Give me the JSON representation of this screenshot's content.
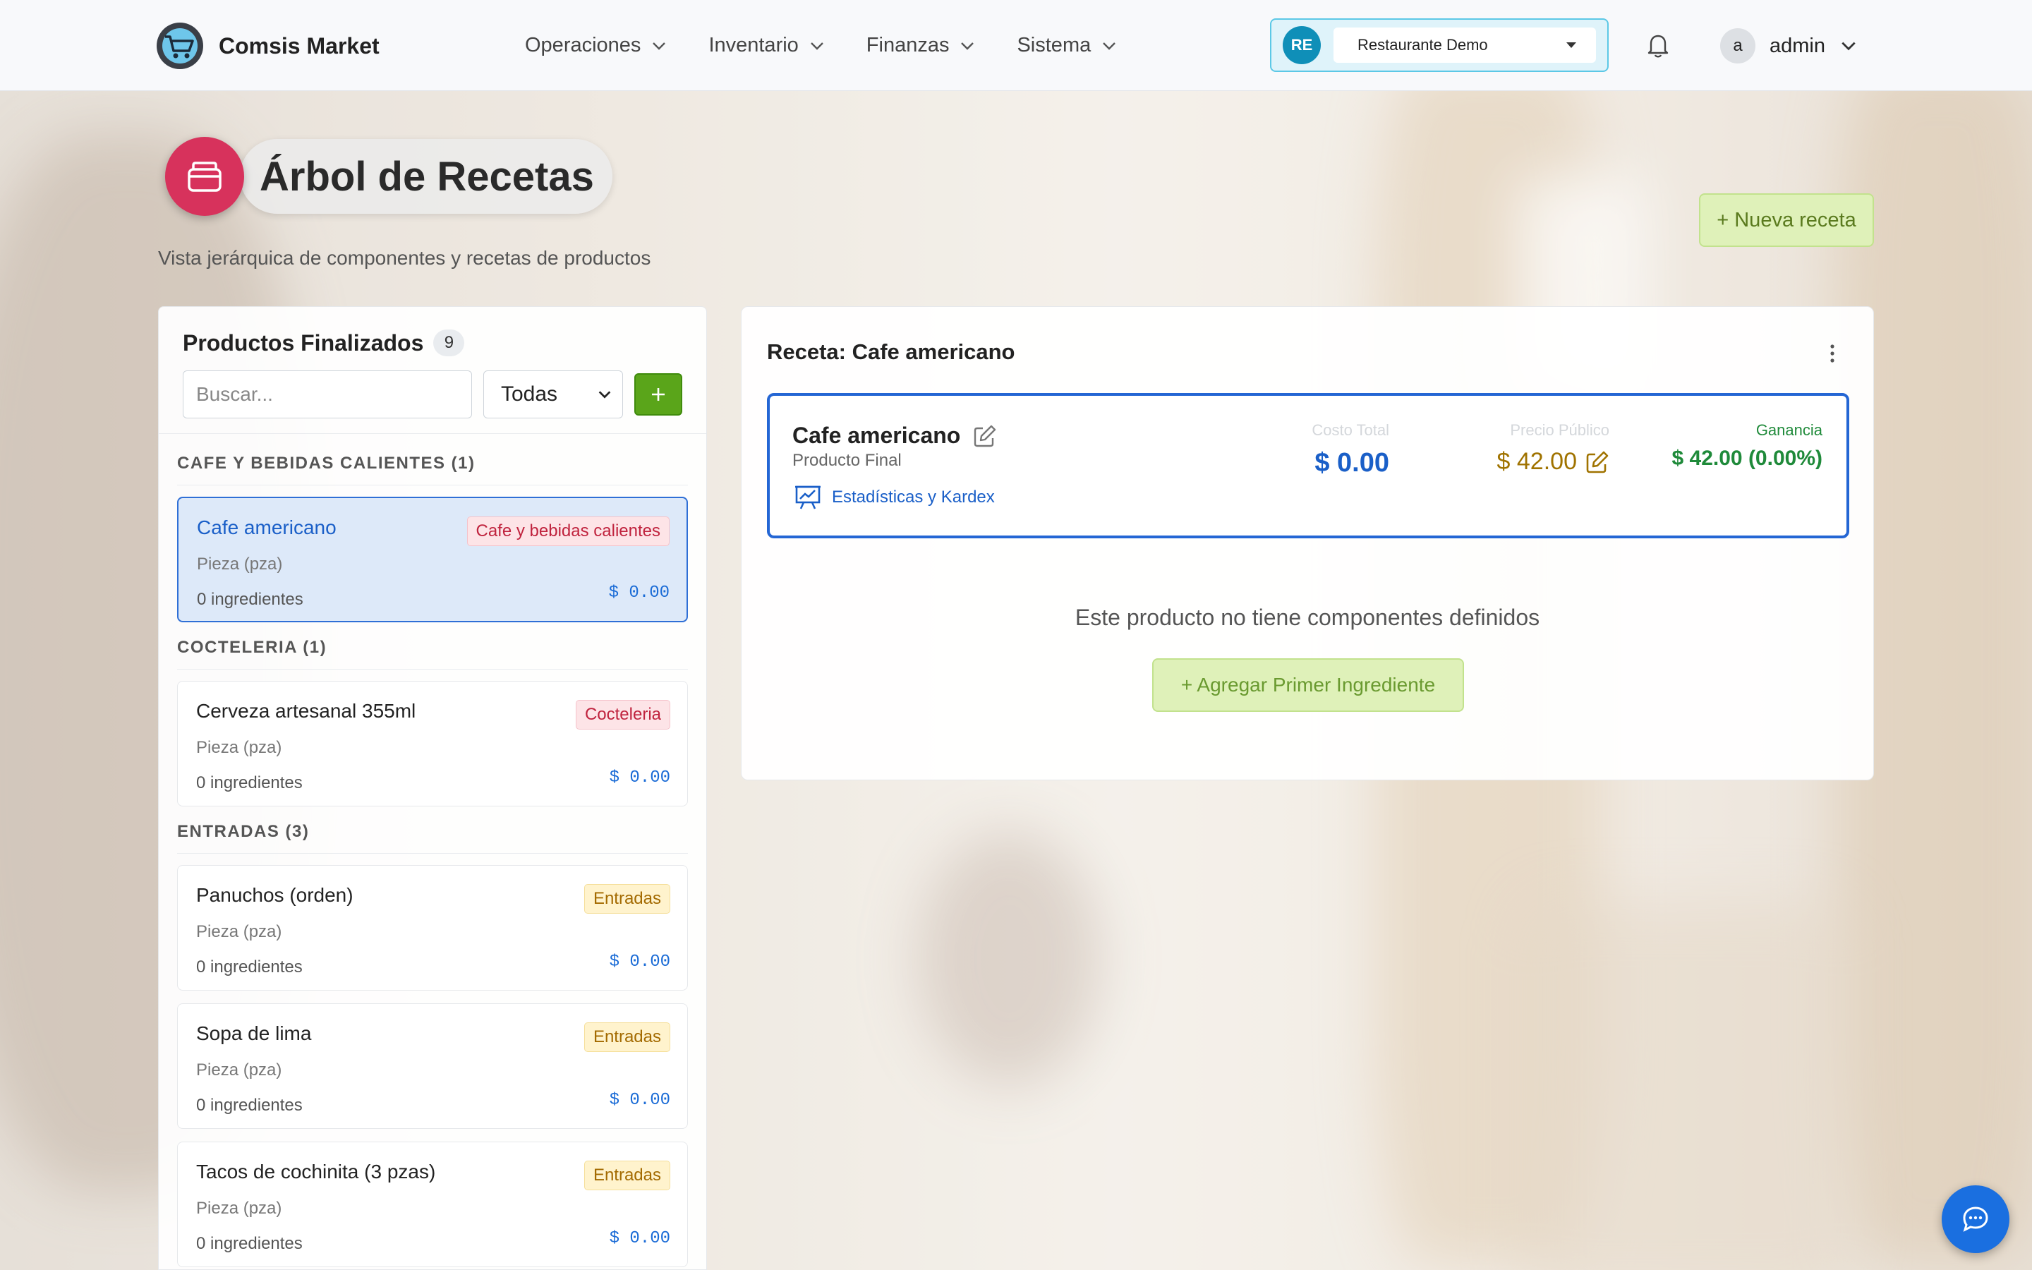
{
  "brand": {
    "name": "Comsis Market"
  },
  "nav": {
    "items": [
      {
        "label": "Operaciones"
      },
      {
        "label": "Inventario"
      },
      {
        "label": "Finanzas"
      },
      {
        "label": "Sistema"
      }
    ]
  },
  "org": {
    "initials": "RE",
    "selected": "Restaurante Demo"
  },
  "user": {
    "avatar": "a",
    "name": "admin"
  },
  "page": {
    "title": "Árbol de Recetas",
    "subtitle": "Vista jerárquica de componentes y recetas de productos",
    "new_recipe_label": "+ Nueva receta"
  },
  "left_panel": {
    "title": "Productos Finalizados",
    "count": "9",
    "search_placeholder": "Buscar...",
    "filter_value": "Todas",
    "add_label": "+",
    "groups": [
      {
        "label": "CAFE Y BEBIDAS CALIENTES (1)",
        "items": [
          {
            "name": "Cafe americano",
            "tag": "Cafe y bebidas calientes",
            "unit": "Pieza (pza)",
            "ingredients": "0 ingredientes",
            "price": "$ 0.00"
          }
        ]
      },
      {
        "label": "COCTELERIA (1)",
        "items": [
          {
            "name": "Cerveza artesanal 355ml",
            "tag": "Cocteleria",
            "unit": "Pieza (pza)",
            "ingredients": "0 ingredientes",
            "price": "$ 0.00"
          }
        ]
      },
      {
        "label": "ENTRADAS (3)",
        "items": [
          {
            "name": "Panuchos (orden)",
            "tag": "Entradas",
            "unit": "Pieza (pza)",
            "ingredients": "0 ingredientes",
            "price": "$ 0.00"
          },
          {
            "name": "Sopa de lima",
            "tag": "Entradas",
            "unit": "Pieza (pza)",
            "ingredients": "0 ingredientes",
            "price": "$ 0.00"
          },
          {
            "name": "Tacos de cochinita (3 pzas)",
            "tag": "Entradas",
            "unit": "Pieza (pza)",
            "ingredients": "0 ingredientes",
            "price": "$ 0.00"
          }
        ]
      }
    ]
  },
  "recipe": {
    "header": "Receta: Cafe americano",
    "name": "Cafe americano",
    "type": "Producto Final",
    "stats_link": "Estadísticas y Kardex",
    "cost_label": "Costo Total",
    "cost_value": "$ 0.00",
    "price_label": "Precio Público",
    "price_value": "$ 42.00",
    "profit_label": "Ganancia",
    "profit_value": "$ 42.00 (0.00%)",
    "empty_message": "Este producto no tiene componentes definidos",
    "add_first_label": "+ Agregar Primer Ingrediente"
  },
  "colors": {
    "accent_blue": "#2466d4",
    "title_icon_red": "#d7325c",
    "add_green": "#5aa51a",
    "profit_green": "#1f8a3a",
    "price_gold": "#a07300"
  }
}
